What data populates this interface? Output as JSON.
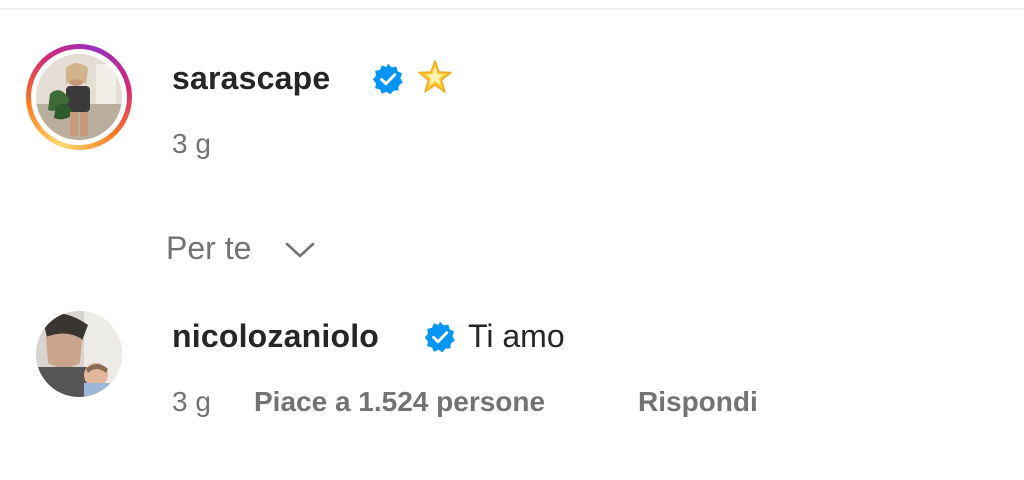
{
  "post": {
    "author": {
      "username": "sarascape",
      "verified": true,
      "badge_emoji": "🌟",
      "time_ago": "3 g"
    }
  },
  "comments_sort": {
    "label": "Per te"
  },
  "comments": [
    {
      "username": "nicolozaniolo",
      "verified": true,
      "text": "Ti amo",
      "time_ago": "3 g",
      "likes_text": "Piace a 1.524 persone",
      "reply_label": "Rispondi"
    }
  ],
  "colors": {
    "primary_text": "#262626",
    "secondary_text": "#737373",
    "verified_blue": "#0095f6"
  }
}
